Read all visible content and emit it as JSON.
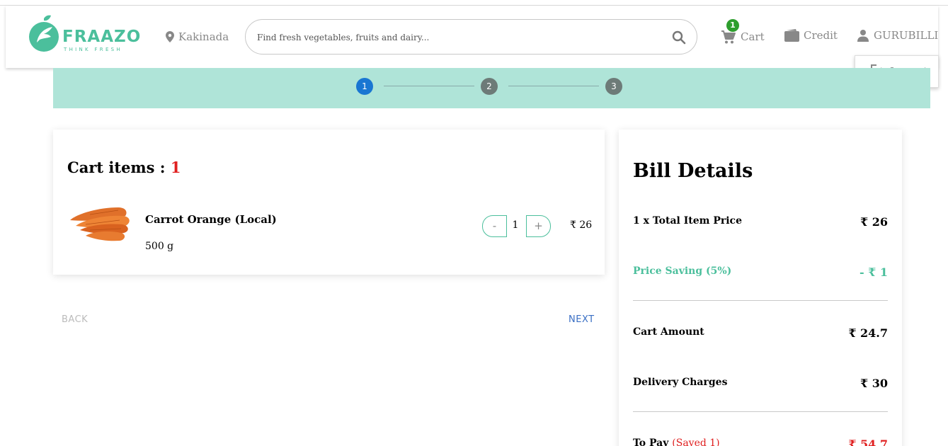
{
  "header": {
    "logo_text": "FRAAZO",
    "logo_tagline": "THINK FRESH",
    "location": "Kakinada",
    "search_placeholder": "Find fresh vegetables, fruits and dairy...",
    "cart_label": "Cart",
    "cart_count": "1",
    "credit_label": "Credit",
    "user_name": "GURUBILLI",
    "logout_label": "Logout"
  },
  "stepper": {
    "steps": [
      "1",
      "2",
      "3"
    ],
    "active_step": 1,
    "active_color": "#1976d2",
    "inactive_color": "#6d7b78"
  },
  "cart": {
    "title": "Cart items :",
    "count": "1",
    "items": [
      {
        "name": "Carrot Orange (Local)",
        "weight": "500 g",
        "quantity": "1",
        "price": "₹ 26",
        "minus": "-",
        "plus": "+"
      }
    ]
  },
  "nav": {
    "back_label": "BACK",
    "next_label": "NEXT"
  },
  "bill": {
    "title": "Bill Details",
    "rows": {
      "item_price": {
        "label": "1 x Total Item Price",
        "value": "₹ 26"
      },
      "saving": {
        "label": "Price Saving (5%)",
        "value": "- ₹ 1"
      },
      "cart_amount": {
        "label": "Cart Amount",
        "value": "₹ 24.7"
      },
      "delivery": {
        "label": "Delivery Charges",
        "value": "₹ 30"
      },
      "to_pay": {
        "label": "To Pay",
        "saved": "(Saved 1)",
        "value": "₹ 54.7"
      }
    }
  },
  "colors": {
    "brand": "#4bbf9c",
    "stepper_bg": "#afe4d8",
    "accent_red": "#e02020",
    "next_blue": "#3a6fc4",
    "badge_green": "#2e9e2e"
  }
}
